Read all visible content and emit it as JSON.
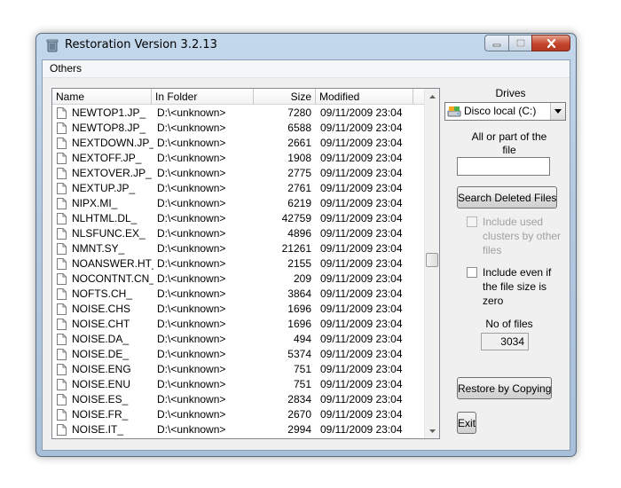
{
  "window": {
    "title": "Restoration Version 3.2.13"
  },
  "menu": {
    "items": [
      "Others"
    ]
  },
  "list": {
    "columns": [
      "Name",
      "In Folder",
      "Size",
      "Modified"
    ],
    "rows": [
      {
        "name": "NEWTOP1.JP_",
        "folder": "D:\\<unknown>",
        "size": "7280",
        "modified": "09/11/2009 23:04"
      },
      {
        "name": "NEWTOP8.JP_",
        "folder": "D:\\<unknown>",
        "size": "6588",
        "modified": "09/11/2009 23:04"
      },
      {
        "name": "NEXTDOWN.JP_",
        "folder": "D:\\<unknown>",
        "size": "2661",
        "modified": "09/11/2009 23:04"
      },
      {
        "name": "NEXTOFF.JP_",
        "folder": "D:\\<unknown>",
        "size": "1908",
        "modified": "09/11/2009 23:04"
      },
      {
        "name": "NEXTOVER.JP_",
        "folder": "D:\\<unknown>",
        "size": "2775",
        "modified": "09/11/2009 23:04"
      },
      {
        "name": "NEXTUP.JP_",
        "folder": "D:\\<unknown>",
        "size": "2761",
        "modified": "09/11/2009 23:04"
      },
      {
        "name": "NIPX.MI_",
        "folder": "D:\\<unknown>",
        "size": "6219",
        "modified": "09/11/2009 23:04"
      },
      {
        "name": "NLHTML.DL_",
        "folder": "D:\\<unknown>",
        "size": "42759",
        "modified": "09/11/2009 23:04"
      },
      {
        "name": "NLSFUNC.EX_",
        "folder": "D:\\<unknown>",
        "size": "4896",
        "modified": "09/11/2009 23:04"
      },
      {
        "name": "NMNT.SY_",
        "folder": "D:\\<unknown>",
        "size": "21261",
        "modified": "09/11/2009 23:04"
      },
      {
        "name": "NOANSWER.HT_",
        "folder": "D:\\<unknown>",
        "size": "2155",
        "modified": "09/11/2009 23:04"
      },
      {
        "name": "NOCONTNT.CN_",
        "folder": "D:\\<unknown>",
        "size": "209",
        "modified": "09/11/2009 23:04"
      },
      {
        "name": "NOFTS.CH_",
        "folder": "D:\\<unknown>",
        "size": "3864",
        "modified": "09/11/2009 23:04"
      },
      {
        "name": "NOISE.CHS",
        "folder": "D:\\<unknown>",
        "size": "1696",
        "modified": "09/11/2009 23:04"
      },
      {
        "name": "NOISE.CHT",
        "folder": "D:\\<unknown>",
        "size": "1696",
        "modified": "09/11/2009 23:04"
      },
      {
        "name": "NOISE.DA_",
        "folder": "D:\\<unknown>",
        "size": "494",
        "modified": "09/11/2009 23:04"
      },
      {
        "name": "NOISE.DE_",
        "folder": "D:\\<unknown>",
        "size": "5374",
        "modified": "09/11/2009 23:04"
      },
      {
        "name": "NOISE.ENG",
        "folder": "D:\\<unknown>",
        "size": "751",
        "modified": "09/11/2009 23:04"
      },
      {
        "name": "NOISE.ENU",
        "folder": "D:\\<unknown>",
        "size": "751",
        "modified": "09/11/2009 23:04"
      },
      {
        "name": "NOISE.ES_",
        "folder": "D:\\<unknown>",
        "size": "2834",
        "modified": "09/11/2009 23:04"
      },
      {
        "name": "NOISE.FR_",
        "folder": "D:\\<unknown>",
        "size": "2670",
        "modified": "09/11/2009 23:04"
      },
      {
        "name": "NOISE.IT_",
        "folder": "D:\\<unknown>",
        "size": "2994",
        "modified": "09/11/2009 23:04"
      }
    ]
  },
  "side": {
    "drives_label": "Drives",
    "drive_selected": "Disco local (C:)",
    "search_label": "All or part of the file",
    "search_value": "",
    "search_button": "Search Deleted Files",
    "include_used_label": "Include used clusters by other files",
    "include_used_checked": false,
    "include_used_enabled": false,
    "include_zero_label": "Include even if the file size is zero",
    "include_zero_checked": false,
    "count_label": "No of files",
    "count_value": "3034",
    "restore_button": "Restore by Copying",
    "exit_button": "Exit"
  },
  "icons": {
    "app": "recycle-bin-icon",
    "drive": "hard-drive-icon",
    "file": "document-icon"
  }
}
